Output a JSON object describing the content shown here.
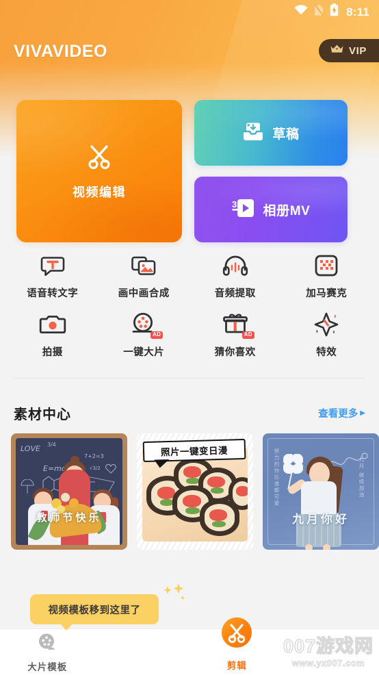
{
  "status_bar": {
    "time": "8:11",
    "icons": [
      "wifi-icon",
      "sim-card-off-icon",
      "battery-charging-icon"
    ]
  },
  "app_bar": {
    "brand": "VIVAVIDEO",
    "vip_label": "VIP",
    "vip_icon": "crown-icon",
    "vip_bg": "#4a3422"
  },
  "cards": {
    "video_edit": {
      "label": "视频编辑",
      "icon": "scissors-icon",
      "color": "#fb8a10"
    },
    "draft": {
      "label": "草稿",
      "icon": "draft-tray-icon",
      "color": "#2f95de"
    },
    "album_mv": {
      "label": "相册MV",
      "icon": "3d-video-icon",
      "color": "#8550f0"
    }
  },
  "features": [
    {
      "label": "语音转文字",
      "icon": "speech-to-text-icon",
      "ad": false
    },
    {
      "label": "画中画合成",
      "icon": "picture-in-picture-icon",
      "ad": false
    },
    {
      "label": "音频提取",
      "icon": "headphones-audio-icon",
      "ad": false
    },
    {
      "label": "加马赛克",
      "icon": "mosaic-icon",
      "ad": false
    },
    {
      "label": "拍摄",
      "icon": "camera-icon",
      "ad": false
    },
    {
      "label": "一键大片",
      "icon": "film-reel-icon",
      "ad": true
    },
    {
      "label": "猜你喜欢",
      "icon": "gift-icon",
      "ad": true
    },
    {
      "label": "特效",
      "icon": "sparkle-effects-icon",
      "ad": false
    }
  ],
  "ad_badge_text": "AD",
  "material_center": {
    "title": "素材中心",
    "more_label": "查看更多",
    "more_arrow": "▶",
    "more_color": "#3d9bf0",
    "cards": [
      {
        "caption": "教师节快乐",
        "kind": "teachers-day-blackboard",
        "chalk": [
          "LOVE",
          "3/4",
          "7+2=3",
          "E=mc²",
          "√3/2"
        ]
      },
      {
        "caption": "照片一键变日漫",
        "kind": "sushi-anime-banner"
      },
      {
        "caption": "九月你好",
        "kind": "september-girl-pinwheel",
        "side_text_left": "努力的你比谁都可爱",
        "side_text_right": "九月 继续加油"
      }
    ]
  },
  "tooltip": {
    "text": "视频模板移到这里了",
    "bg": "#fbd164"
  },
  "bottom_nav": {
    "items": [
      {
        "label": "大片模板",
        "icon": "film-reel-nav-icon",
        "active": false
      },
      {
        "label": "剪辑",
        "icon": "scissors-nav-icon",
        "active": true
      }
    ],
    "active_color": "#f96f12"
  },
  "watermark": {
    "main": "007游戏网",
    "sub": "www.yx007.com"
  }
}
